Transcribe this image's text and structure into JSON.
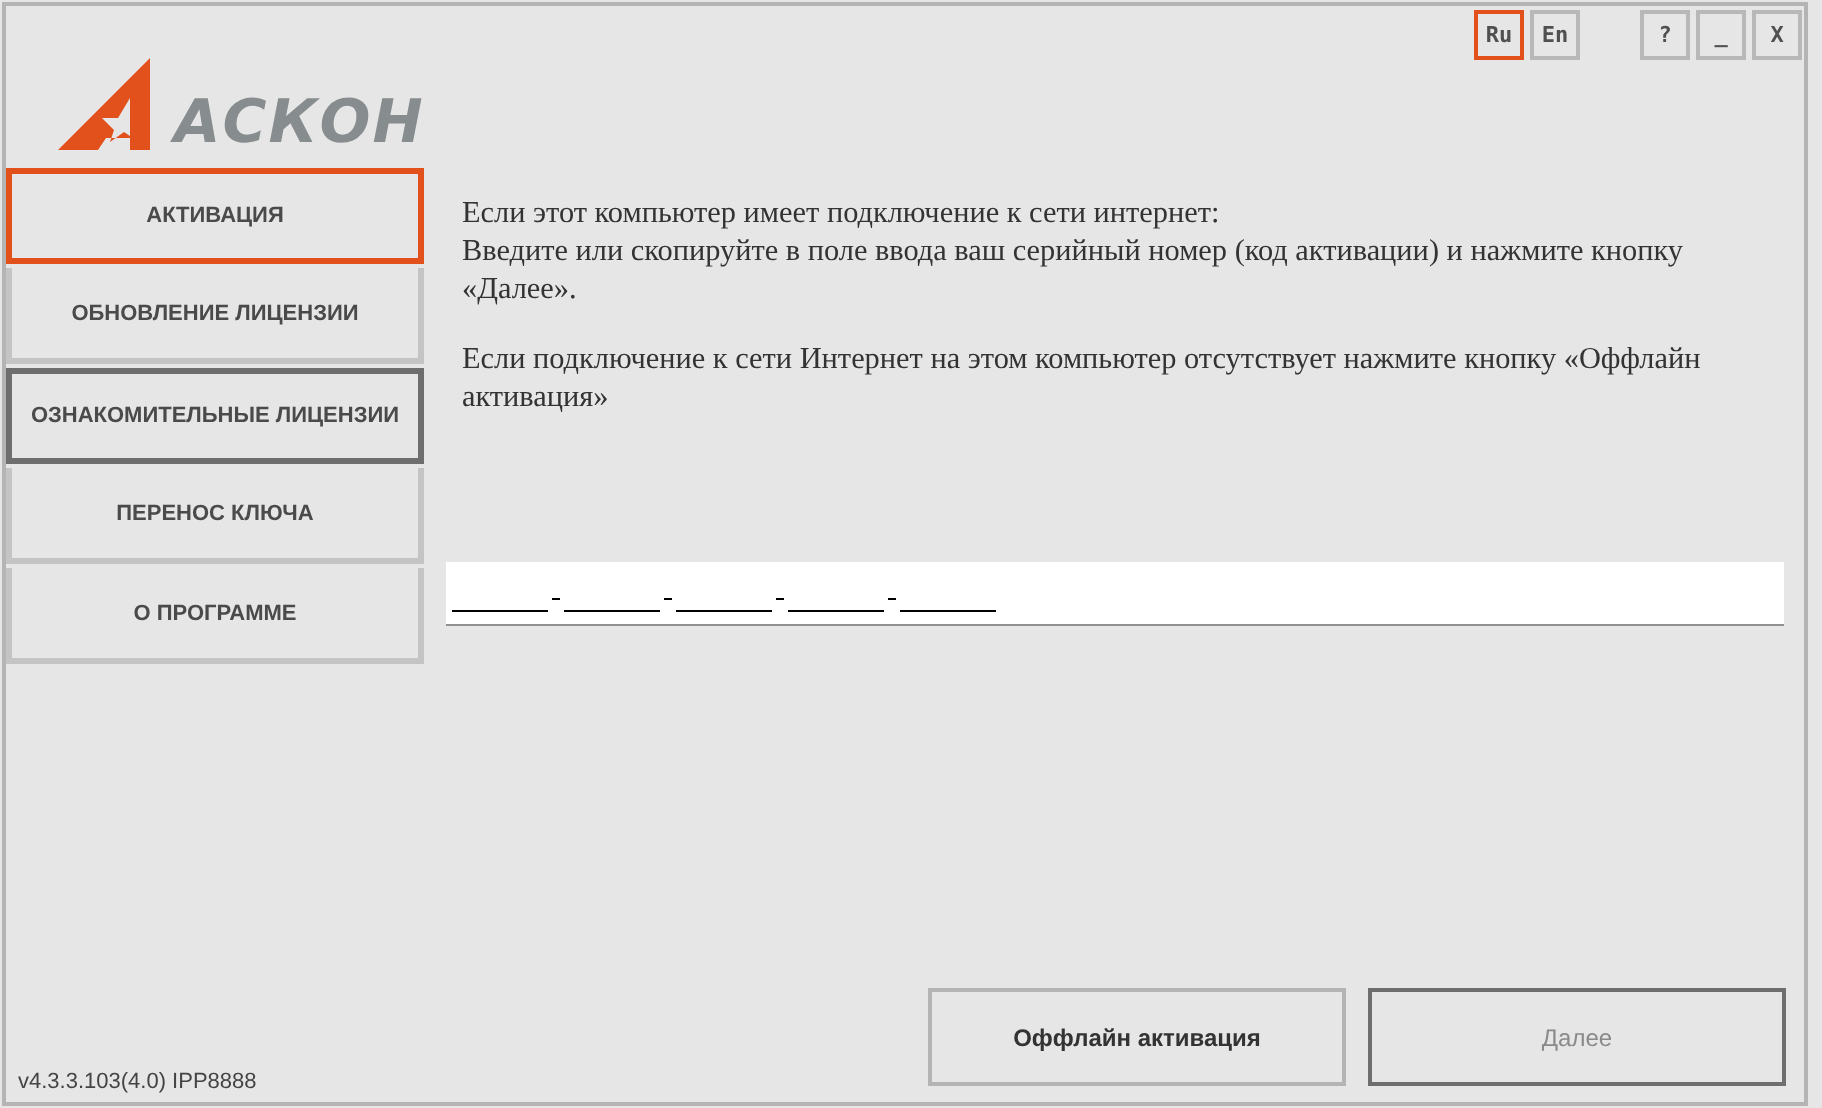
{
  "logo": {
    "text": "АСКОН"
  },
  "languages": [
    {
      "label": "Ru",
      "selected": true
    },
    {
      "label": "En",
      "selected": false
    }
  ],
  "window_buttons": [
    "?",
    "_",
    "X"
  ],
  "sidebar": {
    "items": [
      {
        "label": "АКТИВАЦИЯ",
        "selected": true,
        "focused": false
      },
      {
        "label": "ОБНОВЛЕНИЕ ЛИЦЕНЗИИ",
        "selected": false,
        "focused": false
      },
      {
        "label": "ОЗНАКОМИТЕЛЬНЫЕ ЛИЦЕНЗИИ",
        "selected": false,
        "focused": true
      },
      {
        "label": "ПЕРЕНОС КЛЮЧА",
        "selected": false,
        "focused": false
      },
      {
        "label": "О ПРОГРАММЕ",
        "selected": false,
        "focused": false
      }
    ]
  },
  "instructions": [
    "Если этот компьютер имеет подключение к сети интернет:\nВведите или скопируйте в поле ввода ваш серийный номер (код активации) и нажмите кнопку «Далее».",
    "Если подключение к сети Интернет на этом компьютер отсутствует нажмите кнопку «Оффлайн активация»"
  ],
  "buttons": [
    {
      "label": "Оффлайн активация",
      "disabled": false,
      "focused": false
    },
    {
      "label": "Далее",
      "disabled": true,
      "focused": true
    }
  ],
  "version": "v4.3.3.103(4.0) IPP8888"
}
